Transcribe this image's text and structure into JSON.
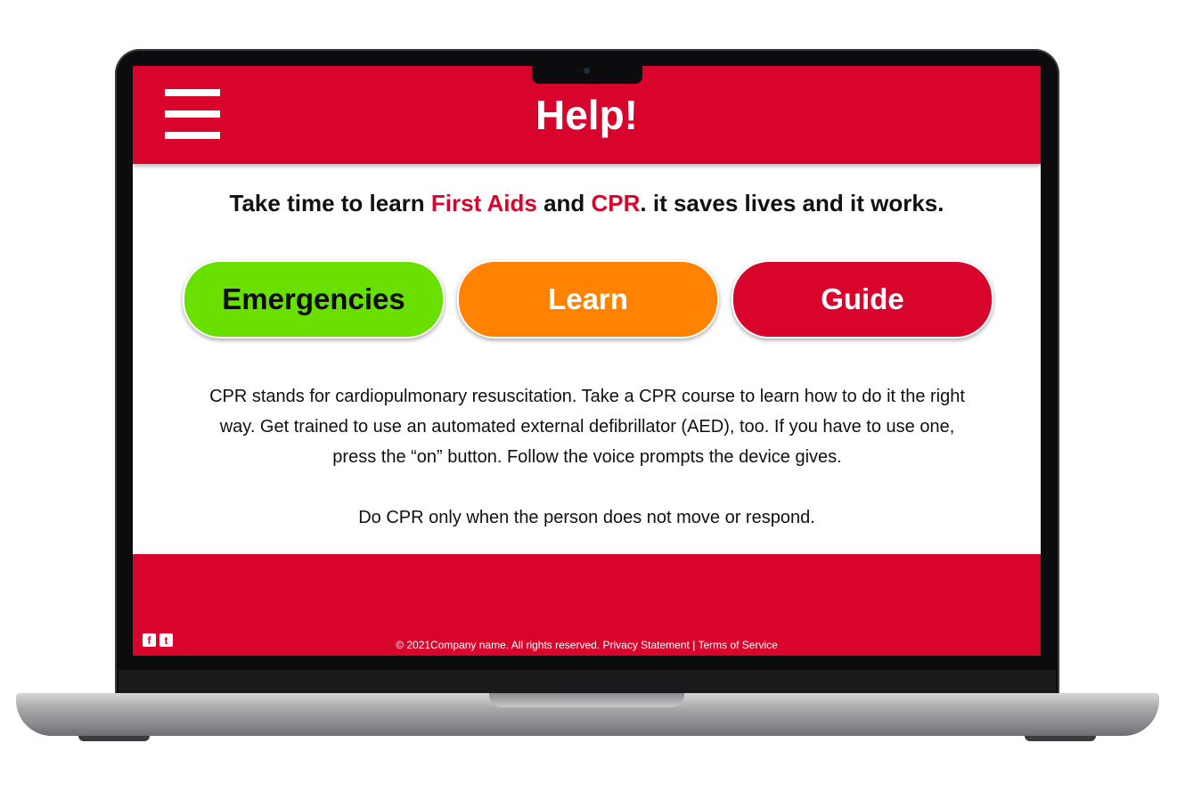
{
  "header": {
    "title": "Help!",
    "menu_icon": "hamburger-menu-icon"
  },
  "intro": {
    "part1": "Take time to learn ",
    "highlight1": "First Aids",
    "part2": " and ",
    "highlight2": "CPR",
    "part3": ". it saves lives and it works."
  },
  "buttons": [
    {
      "label": "Emergencies",
      "color": "#6ae000"
    },
    {
      "label": "Learn",
      "color": "#ff8200"
    },
    {
      "label": "Guide",
      "color": "#d9042b"
    }
  ],
  "content": {
    "paragraph1": "CPR stands for cardiopulmonary resuscitation. Take a CPR course to learn how to do it the right way. Get trained to use an automated external defibrillator (AED), too. If you have to use one, press the “on” button. Follow the voice prompts the device gives.",
    "paragraph2": "Do CPR only when the person does not move or respond."
  },
  "footer": {
    "social": [
      {
        "icon": "facebook-icon",
        "glyph": "f"
      },
      {
        "icon": "twitter-icon",
        "glyph": "t"
      }
    ],
    "copyright": "© 2021Company name. All rights reserved. ",
    "privacy": "Privacy Statement",
    "separator": " | ",
    "terms": "Terms of Service"
  },
  "colors": {
    "brand_red": "#d9042b",
    "green": "#6ae000",
    "orange": "#ff8200"
  }
}
